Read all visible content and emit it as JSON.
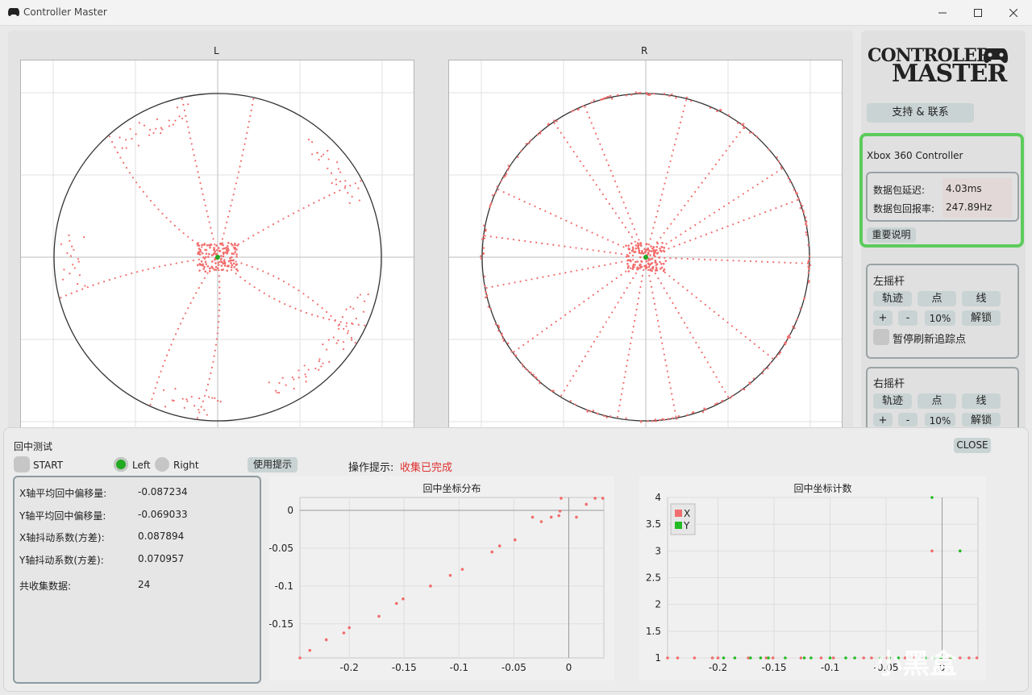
{
  "window": {
    "title": "Controller Master"
  },
  "stick_plots": {
    "left_title": "L",
    "right_title": "R"
  },
  "side": {
    "logo_line1": "CONTROLER",
    "logo_line2": "MASTER",
    "support_button": "支持 & 联系",
    "device_name": "Xbox 360 Controller",
    "latency_label": "数据包延迟:",
    "latency_value": "4.03ms",
    "rate_label": "数据包回报率:",
    "rate_value": "247.89Hz",
    "notes_button": "重要说明",
    "left_stick": {
      "title": "左摇杆",
      "trail": "轨迹",
      "dot": "点",
      "line": "线",
      "plus": "+",
      "minus": "-",
      "percent": "10%",
      "unlock": "解锁",
      "pause": "暂停刷新追踪点"
    },
    "right_stick": {
      "title": "右摇杆",
      "trail": "轨迹",
      "dot": "点",
      "line": "线",
      "plus": "+",
      "minus": "-",
      "percent": "10%",
      "unlock": "解锁"
    }
  },
  "center_test": {
    "title": "回中测试",
    "start": "START",
    "left": "Left",
    "right": "Right",
    "hint_button": "使用提示",
    "op_label": "操作提示:",
    "op_status": "收集已完成",
    "close": "CLOSE",
    "stats": [
      {
        "label": "X轴平均回中偏移量:",
        "value": "-0.087234"
      },
      {
        "label": "Y轴平均回中偏移量:",
        "value": "-0.069033"
      },
      {
        "label": "X轴抖动系数(方差):",
        "value": "0.087894"
      },
      {
        "label": "Y轴抖动系数(方差):",
        "value": "0.070957"
      },
      {
        "label": "共收集数据:",
        "value": "24"
      }
    ]
  },
  "watermark": "小黑盒",
  "colors": {
    "trace": "#f26d6d",
    "center_dot": "#22aa22",
    "highlight_border": "#5ccc5c",
    "status_text": "#e03030"
  },
  "chart_data": [
    {
      "type": "scatter",
      "title": "回中坐标分布",
      "xlabel": "",
      "ylabel": "",
      "xlim": [
        -0.245,
        0.032
      ],
      "ylim": [
        -0.195,
        0.017
      ],
      "xticks": [
        "-0.2",
        "-0.15",
        "-0.1",
        "-0.05",
        "0"
      ],
      "yticks": [
        "0",
        "-0.05",
        "-0.1",
        "-0.15"
      ],
      "grid": true,
      "series": [
        {
          "color": "#f26d6d",
          "points": [
            [
              -0.245,
              -0.195
            ],
            [
              -0.236,
              -0.185
            ],
            [
              -0.221,
              -0.171
            ],
            [
              -0.205,
              -0.162
            ],
            [
              -0.2,
              -0.155
            ],
            [
              -0.173,
              -0.14
            ],
            [
              -0.157,
              -0.123
            ],
            [
              -0.151,
              -0.117
            ],
            [
              -0.126,
              -0.1
            ],
            [
              -0.108,
              -0.086
            ],
            [
              -0.097,
              -0.078
            ],
            [
              -0.07,
              -0.055
            ],
            [
              -0.063,
              -0.047
            ],
            [
              -0.049,
              -0.039
            ],
            [
              -0.033,
              -0.009
            ],
            [
              -0.025,
              -0.015
            ],
            [
              -0.016,
              -0.009
            ],
            [
              -0.009,
              -0.007
            ],
            [
              -0.008,
              -0.001
            ],
            [
              -0.007,
              0.016
            ],
            [
              0.007,
              -0.009
            ],
            [
              0.016,
              0.008
            ],
            [
              0.024,
              0.016
            ],
            [
              0.031,
              0.016
            ]
          ]
        }
      ]
    },
    {
      "type": "scatter",
      "title": "回中坐标计数",
      "xlabel": "",
      "ylabel": "",
      "xlim": [
        -0.245,
        0.032
      ],
      "ylim": [
        1,
        4
      ],
      "xticks": [
        "-0.2",
        "-0.15",
        "-0.1",
        "-0.05",
        "0"
      ],
      "yticks": [
        "4",
        "3.5",
        "3",
        "2.5",
        "2",
        "1.5",
        "1"
      ],
      "legend": "top-left",
      "grid": true,
      "series": [
        {
          "name": "X",
          "color": "#f26d6d",
          "points": [
            [
              -0.245,
              1
            ],
            [
              -0.236,
              1
            ],
            [
              -0.221,
              1
            ],
            [
              -0.205,
              1
            ],
            [
              -0.2,
              1
            ],
            [
              -0.173,
              1
            ],
            [
              -0.157,
              1
            ],
            [
              -0.151,
              1
            ],
            [
              -0.126,
              1
            ],
            [
              -0.108,
              1
            ],
            [
              -0.097,
              1
            ],
            [
              -0.07,
              1
            ],
            [
              -0.063,
              1
            ],
            [
              -0.049,
              1
            ],
            [
              -0.033,
              1
            ],
            [
              -0.025,
              1
            ],
            [
              -0.016,
              1
            ],
            [
              -0.009,
              3
            ],
            [
              0.007,
              1
            ],
            [
              0.016,
              1
            ],
            [
              0.024,
              1
            ],
            [
              0.031,
              1
            ]
          ]
        },
        {
          "name": "Y",
          "color": "#22bb22",
          "points": [
            [
              -0.195,
              1
            ],
            [
              -0.185,
              1
            ],
            [
              -0.171,
              1
            ],
            [
              -0.162,
              1
            ],
            [
              -0.155,
              1
            ],
            [
              -0.14,
              1
            ],
            [
              -0.123,
              1
            ],
            [
              -0.117,
              1
            ],
            [
              -0.1,
              1
            ],
            [
              -0.086,
              1
            ],
            [
              -0.078,
              1
            ],
            [
              -0.055,
              1
            ],
            [
              -0.047,
              1
            ],
            [
              -0.039,
              1
            ],
            [
              -0.015,
              1
            ],
            [
              -0.009,
              4
            ],
            [
              -0.007,
              1
            ],
            [
              -0.001,
              1
            ],
            [
              0.008,
              1
            ],
            [
              0.016,
              3
            ]
          ]
        }
      ]
    }
  ]
}
